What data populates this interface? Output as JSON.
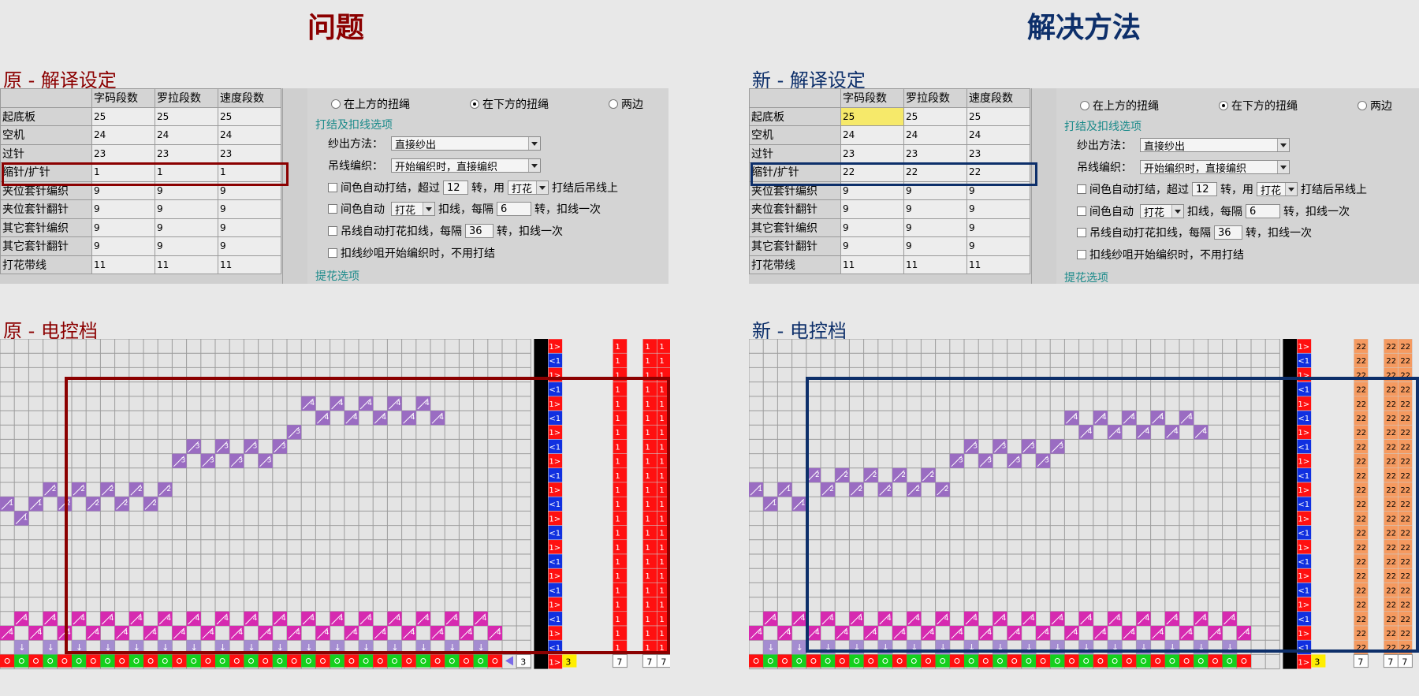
{
  "header": {
    "problem_title": "问题",
    "solution_title": "解决方法"
  },
  "colors": {
    "problem": "#8b0000",
    "solution": "#0d2f6a"
  },
  "original": {
    "settings_label": "原 - 解译设定",
    "grid_label": "原 - 电控档",
    "table": {
      "headers": [
        "",
        "字码段数",
        "罗拉段数",
        "速度段数"
      ],
      "rows": [
        [
          "起底板",
          "25",
          "25",
          "25"
        ],
        [
          "空机",
          "24",
          "24",
          "24"
        ],
        [
          "过针",
          "23",
          "23",
          "23"
        ],
        [
          "缩针/扩针",
          "1",
          "1",
          "1"
        ],
        [
          "夹位套针编织",
          "9",
          "9",
          "9"
        ],
        [
          "夹位套针翻针",
          "9",
          "9",
          "9"
        ],
        [
          "其它套针编织",
          "9",
          "9",
          "9"
        ],
        [
          "其它套针翻针",
          "9",
          "9",
          "9"
        ],
        [
          "打花带线",
          "11",
          "11",
          "11"
        ]
      ]
    },
    "grid_values": {
      "speed": "1",
      "counter": "3",
      "tail": "7"
    }
  },
  "new": {
    "settings_label": "新 - 解译设定",
    "grid_label": "新 - 电控档",
    "table": {
      "headers": [
        "",
        "字码段数",
        "罗拉段数",
        "速度段数"
      ],
      "rows": [
        [
          "起底板",
          "25",
          "25",
          "25"
        ],
        [
          "空机",
          "24",
          "24",
          "24"
        ],
        [
          "过针",
          "23",
          "23",
          "23"
        ],
        [
          "缩针/扩针",
          "22",
          "22",
          "22"
        ],
        [
          "夹位套针编织",
          "9",
          "9",
          "9"
        ],
        [
          "夹位套针翻针",
          "9",
          "9",
          "9"
        ],
        [
          "其它套针编织",
          "9",
          "9",
          "9"
        ],
        [
          "其它套针翻针",
          "9",
          "9",
          "9"
        ],
        [
          "打花带线",
          "11",
          "11",
          "11"
        ]
      ]
    },
    "grid_values": {
      "speed": "22",
      "counter": "3",
      "tail": "7"
    }
  },
  "options": {
    "radio_upper": "在上方的扭绳",
    "radio_lower": "在下方的扭绳",
    "radio_both": "两边",
    "section_knot": "打结及扣线选项",
    "yarn_out_label": "纱出方法：",
    "yarn_out_value": "直接纱出",
    "hang_label": "吊线编织：",
    "hang_value": "开始编织时，直接编织",
    "auto_knot_pre": "间色自动打结，超过",
    "auto_knot_num": "12",
    "auto_knot_mid": "转，用",
    "auto_knot_sel": "打花",
    "auto_knot_post": "打结后吊线上",
    "auto_tie_pre": "间色自动",
    "auto_tie_sel": "打花",
    "auto_tie_mid": "扣线，每隔",
    "auto_tie_num": "6",
    "auto_tie_post": "转，扣线一次",
    "hang_tie_pre": "吊线自动打花扣线，每隔",
    "hang_tie_num": "36",
    "hang_tie_post": "转，扣线一次",
    "no_knot": "扣线纱咀开始编织时，不用打结",
    "jacquard": "提花选项"
  }
}
